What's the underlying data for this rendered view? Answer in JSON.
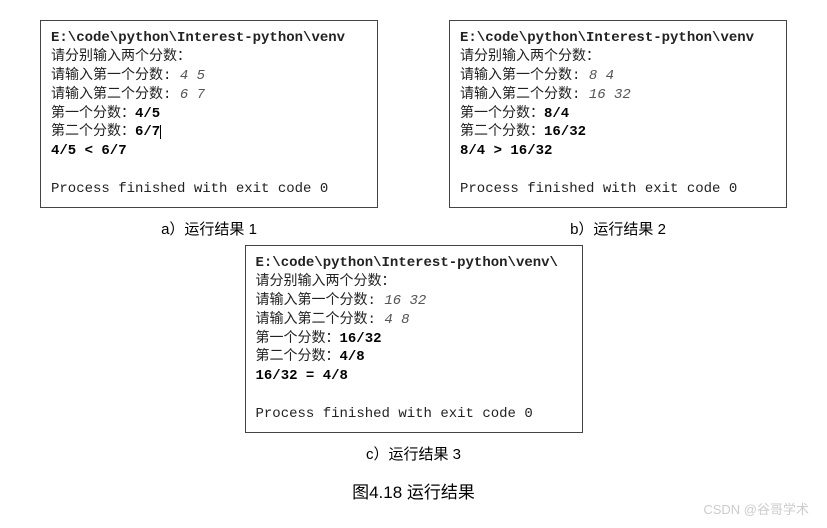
{
  "panelA": {
    "path": "E:\\code\\python\\Interest-python\\venv",
    "prompt": "请分别输入两个分数：",
    "in1_label": "请输入第一个分数: ",
    "in1_val": "4 5",
    "in2_label": "请输入第二个分数: ",
    "in2_val": "6 7",
    "out1_label": "第一个分数：",
    "out1_val": "4/5",
    "out2_label": "第二个分数：",
    "out2_val": "6/7",
    "compare": "4/5 < 6/7",
    "exit": "Process finished with exit code 0",
    "caption": "a）运行结果 1"
  },
  "panelB": {
    "path": "E:\\code\\python\\Interest-python\\venv",
    "prompt": "请分别输入两个分数：",
    "in1_label": "请输入第一个分数: ",
    "in1_val": "8 4",
    "in2_label": "请输入第二个分数: ",
    "in2_val": "16 32",
    "out1_label": "第一个分数：",
    "out1_val": "8/4",
    "out2_label": "第二个分数：",
    "out2_val": "16/32",
    "compare": "8/4 > 16/32",
    "exit": "Process finished with exit code 0",
    "caption": "b）运行结果 2"
  },
  "panelC": {
    "path": "E:\\code\\python\\Interest-python\\venv\\",
    "prompt": "请分别输入两个分数：",
    "in1_label": "请输入第一个分数: ",
    "in1_val": "16 32",
    "in2_label": "请输入第二个分数: ",
    "in2_val": "4 8",
    "out1_label": "第一个分数：",
    "out1_val": "16/32",
    "out2_label": "第二个分数：",
    "out2_val": "4/8",
    "compare": "16/32 = 4/8",
    "exit": "Process finished with exit code 0",
    "caption": "c）运行结果 3"
  },
  "figure_title": "图4.18   运行结果",
  "watermark": "CSDN @谷哥学术"
}
